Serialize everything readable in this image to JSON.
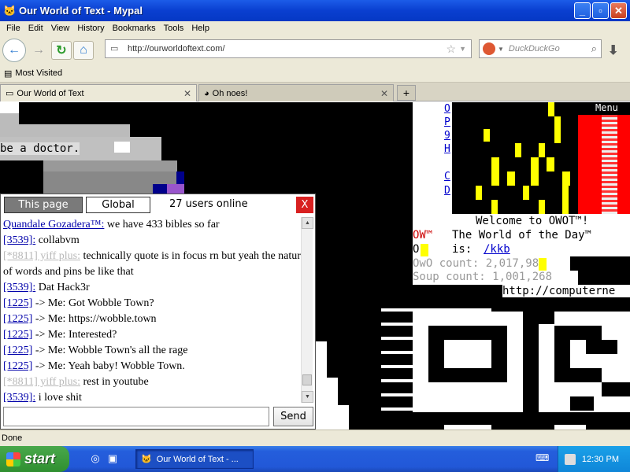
{
  "window": {
    "title": "Our World of Text - Mypal",
    "min_label": "_",
    "max_label": "▫",
    "close_label": "✕"
  },
  "menu": [
    "File",
    "Edit",
    "View",
    "History",
    "Bookmarks",
    "Tools",
    "Help"
  ],
  "nav": {
    "url": "http://ourworldoftext.com/",
    "search_placeholder": "DuckDuckGo"
  },
  "bookmarks": {
    "label": "Most Visited"
  },
  "tabs": [
    {
      "label": "Our World of Text"
    },
    {
      "label": "Oh noes!"
    }
  ],
  "canvas": {
    "doctor_text": "be a doctor.",
    "menu_label": "Menu",
    "welcome": "Welcome to OWOT™!",
    "wotd_prefix": "OW™",
    "wotd_text": "The World of the Day™",
    "wotd_is": "is:",
    "wotd_link": "/kkb",
    "owo_count": "OwO count: 2,017,987",
    "soup_count": "Soup count: 1,001,268",
    "url_fragment": "http://computerne",
    "side_links": [
      "O",
      "P",
      "9",
      "H",
      "C",
      "D"
    ]
  },
  "chat": {
    "tab_page": "This page",
    "tab_global": "Global",
    "online": "27 users online",
    "close": "X",
    "send_label": "Send",
    "messages": [
      {
        "nick": "Quandale Gozadera™:",
        "text": " we have 433 bibles so far"
      },
      {
        "uid": "[3539]:",
        "text": " collabvm"
      },
      {
        "faded": "[*8811] yiff plus:",
        "text": " technically quote is in focus rn but yeah the nature of words and pins be like that"
      },
      {
        "uid": "[3539]:",
        "text": " Dat Hack3r"
      },
      {
        "uid": "[1225]",
        "text": " -> Me: Got Wobble Town?"
      },
      {
        "uid": "[1225]",
        "text": " -> Me: https://wobble.town"
      },
      {
        "uid": "[1225]",
        "text": " -> Me: Interested?"
      },
      {
        "uid": "[1225]",
        "text": " -> Me: Wobble Town's all the rage"
      },
      {
        "uid": "[1225]",
        "text": " -> Me: Yeah baby! Wobble Town."
      },
      {
        "faded": "[*8811] yiff plus:",
        "text": " rest in youtube"
      },
      {
        "uid": "[3539]:",
        "text": " i love shit"
      }
    ]
  },
  "status": {
    "text": "Done"
  },
  "taskbar": {
    "start": "start",
    "item": "Our World of Text - ...",
    "clock": "12:30 PM"
  }
}
